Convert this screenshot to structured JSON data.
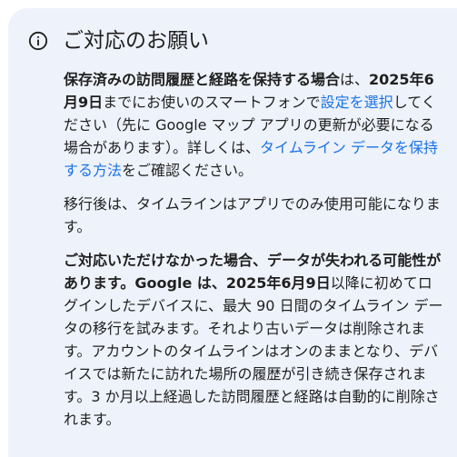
{
  "notice": {
    "icon": "info-icon",
    "title": "ご対応のお願い",
    "p1": {
      "bold": "保存済みの訪問履歴と経路を保持する場合",
      "t1": "は、",
      "date_bold": "2025年6月9日",
      "t2": "までにお使いのスマートフォンで",
      "link1": "設定を選択",
      "t3": "してください（先に Google マップ アプリの更新が必要になる場合があります）。詳しくは、",
      "link2": "タイムライン データを保持する方法",
      "t4": "をご確認ください。"
    },
    "p2": "移行後は、タイムラインはアプリでのみ使用可能になります。",
    "p3": {
      "bold": "ご対応いただけなかった場合、データが失われる可能性があります。Google は、",
      "date_bold": "2025年6月9日",
      "rest": "以降に初めてログインしたデバイスに、最大 90 日間のタイムライン データの移行を試みます。それより古いデータは削除されます。アカウントのタイムラインはオンのままとなり、デバイスでは新たに訪れた場所の履歴が引き続き保存されます。3 か月以上経過した訪問履歴と経路は自動的に削除されます。"
    }
  },
  "colors": {
    "card_bg": "#eef2fa",
    "text": "#1f1f1f",
    "link": "#1a73e8"
  }
}
